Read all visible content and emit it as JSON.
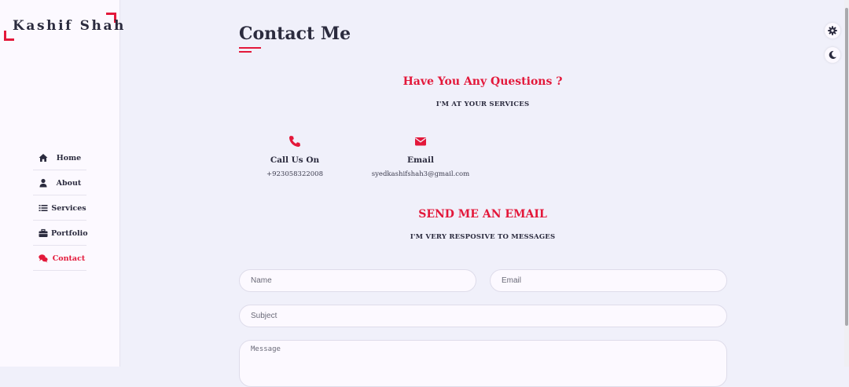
{
  "brand": {
    "name": "Kashif Shah"
  },
  "nav": {
    "items": [
      {
        "label": "Home",
        "icon": "home-icon",
        "active": false
      },
      {
        "label": "About",
        "icon": "user-icon",
        "active": false
      },
      {
        "label": "Services",
        "icon": "list-icon",
        "active": false
      },
      {
        "label": "Portfolio",
        "icon": "briefcase-icon",
        "active": false
      },
      {
        "label": "Contact",
        "icon": "comments-icon",
        "active": true
      }
    ]
  },
  "page": {
    "title": "Contact Me",
    "questions_heading": "Have You Any Questions ?",
    "questions_sub": "I'M AT YOUR SERVICES",
    "call": {
      "heading": "Call Us On",
      "value": "+923058322008",
      "icon": "phone-icon"
    },
    "email": {
      "heading": "Email",
      "value": "syedkashifshah3@gmail.com",
      "icon": "envelope-icon"
    },
    "send_heading": "SEND ME AN EMAIL",
    "send_sub": "I'M VERY RESPOSIVE TO MESSAGES"
  },
  "form": {
    "name_placeholder": "Name",
    "email_placeholder": "Email",
    "subject_placeholder": "Subject",
    "message_placeholder": "Message"
  },
  "controls": {
    "settings_icon": "gear-icon",
    "theme_icon": "moon-icon"
  },
  "colors": {
    "accent": "#e3183a",
    "text": "#2b2b3e",
    "background": "#f0f0fa",
    "sidebar": "#fcf9ff"
  }
}
